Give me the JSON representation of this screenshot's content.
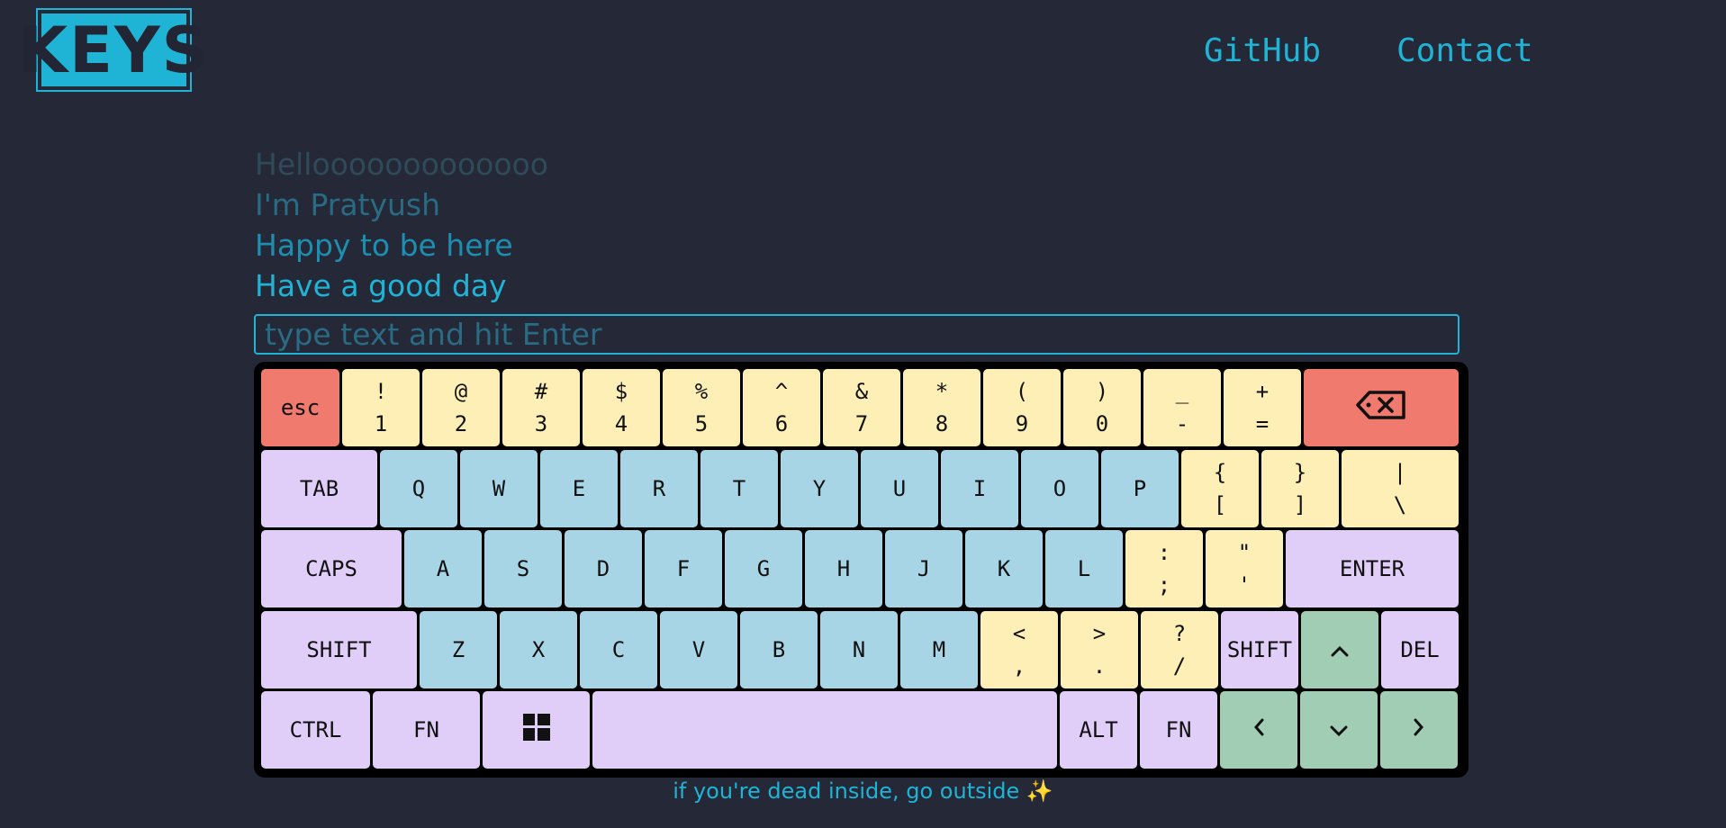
{
  "header": {
    "logo_text": "KEYS",
    "nav": [
      {
        "label": "GitHub"
      },
      {
        "label": "Contact"
      }
    ],
    "theme_icon": "moon-icon"
  },
  "history": [
    "Hellooooooooooooo",
    "I'm Pratyush",
    "Happy to be here",
    "Have a good day"
  ],
  "input": {
    "placeholder": "type text and hit Enter",
    "value": ""
  },
  "keyboard": {
    "rows": [
      [
        {
          "label": "esc",
          "w": 87,
          "color": "red"
        },
        {
          "top": "!",
          "bot": "1",
          "w": 86,
          "color": "yel"
        },
        {
          "top": "@",
          "bot": "2",
          "w": 86,
          "color": "yel"
        },
        {
          "top": "#",
          "bot": "3",
          "w": 86,
          "color": "yel"
        },
        {
          "top": "$",
          "bot": "4",
          "w": 86,
          "color": "yel"
        },
        {
          "top": "%",
          "bot": "5",
          "w": 86,
          "color": "yel"
        },
        {
          "top": "^",
          "bot": "6",
          "w": 86,
          "color": "yel"
        },
        {
          "top": "&",
          "bot": "7",
          "w": 86,
          "color": "yel"
        },
        {
          "top": "*",
          "bot": "8",
          "w": 86,
          "color": "yel"
        },
        {
          "top": "(",
          "bot": "9",
          "w": 86,
          "color": "yel"
        },
        {
          "top": ")",
          "bot": "0",
          "w": 86,
          "color": "yel"
        },
        {
          "top": "_",
          "bot": "-",
          "w": 86,
          "color": "yel"
        },
        {
          "top": "+",
          "bot": "=",
          "w": 86,
          "color": "yel"
        },
        {
          "icon": "backspace-icon",
          "w": 172,
          "color": "red"
        }
      ],
      [
        {
          "label": "TAB",
          "w": 129,
          "color": "pur"
        },
        {
          "label": "Q",
          "w": 86,
          "color": "blu"
        },
        {
          "label": "W",
          "w": 86,
          "color": "blu"
        },
        {
          "label": "E",
          "w": 86,
          "color": "blu"
        },
        {
          "label": "R",
          "w": 86,
          "color": "blu"
        },
        {
          "label": "T",
          "w": 86,
          "color": "blu"
        },
        {
          "label": "Y",
          "w": 86,
          "color": "blu"
        },
        {
          "label": "U",
          "w": 86,
          "color": "blu"
        },
        {
          "label": "I",
          "w": 86,
          "color": "blu"
        },
        {
          "label": "O",
          "w": 86,
          "color": "blu"
        },
        {
          "label": "P",
          "w": 86,
          "color": "blu"
        },
        {
          "top": "{",
          "bot": "[",
          "w": 86,
          "color": "yel"
        },
        {
          "top": "}",
          "bot": "]",
          "w": 86,
          "color": "yel"
        },
        {
          "top": "|",
          "bot": "\\",
          "w": 130,
          "color": "yel"
        }
      ],
      [
        {
          "label": "CAPS",
          "w": 156,
          "color": "pur"
        },
        {
          "label": "A",
          "w": 86,
          "color": "blu"
        },
        {
          "label": "S",
          "w": 86,
          "color": "blu"
        },
        {
          "label": "D",
          "w": 86,
          "color": "blu"
        },
        {
          "label": "F",
          "w": 86,
          "color": "blu"
        },
        {
          "label": "G",
          "w": 86,
          "color": "blu"
        },
        {
          "label": "H",
          "w": 86,
          "color": "blu"
        },
        {
          "label": "J",
          "w": 86,
          "color": "blu"
        },
        {
          "label": "K",
          "w": 86,
          "color": "blu"
        },
        {
          "label": "L",
          "w": 86,
          "color": "blu"
        },
        {
          "top": ":",
          "bot": ";",
          "w": 86,
          "color": "yel"
        },
        {
          "top": "\"",
          "bot": "'",
          "w": 86,
          "color": "yel"
        },
        {
          "label": "ENTER",
          "w": 192,
          "color": "pur"
        }
      ],
      [
        {
          "label": "SHIFT",
          "w": 173,
          "color": "pur"
        },
        {
          "label": "Z",
          "w": 86,
          "color": "blu"
        },
        {
          "label": "X",
          "w": 86,
          "color": "blu"
        },
        {
          "label": "C",
          "w": 86,
          "color": "blu"
        },
        {
          "label": "V",
          "w": 86,
          "color": "blu"
        },
        {
          "label": "B",
          "w": 86,
          "color": "blu"
        },
        {
          "label": "N",
          "w": 86,
          "color": "blu"
        },
        {
          "label": "M",
          "w": 86,
          "color": "blu"
        },
        {
          "top": "<",
          "bot": ",",
          "w": 86,
          "color": "yel"
        },
        {
          "top": ">",
          "bot": ".",
          "w": 86,
          "color": "yel"
        },
        {
          "top": "?",
          "bot": "/",
          "w": 86,
          "color": "yel"
        },
        {
          "label": "SHIFT",
          "w": 86,
          "color": "pur"
        },
        {
          "label": "^",
          "w": 86,
          "color": "grn",
          "icon": "arrow-up-icon"
        },
        {
          "label": "DEL",
          "w": 86,
          "color": "pur"
        }
      ],
      [
        {
          "label": "CTRL",
          "w": 121,
          "color": "pur"
        },
        {
          "label": "FN",
          "w": 119,
          "color": "pur"
        },
        {
          "icon": "windows-icon",
          "w": 119,
          "color": "pur"
        },
        {
          "label": "",
          "w": 516,
          "color": "pur",
          "icon": "spacebar"
        },
        {
          "label": "ALT",
          "w": 86,
          "color": "pur"
        },
        {
          "label": "FN",
          "w": 86,
          "color": "pur"
        },
        {
          "label": "<",
          "w": 86,
          "color": "grn",
          "icon": "arrow-left-icon"
        },
        {
          "label": "v",
          "w": 86,
          "color": "grn",
          "icon": "arrow-down-icon"
        },
        {
          "label": ">",
          "w": 86,
          "color": "grn",
          "icon": "arrow-right-icon"
        }
      ]
    ]
  },
  "footer": {
    "text": "if you're dead inside, go outside ✨"
  }
}
